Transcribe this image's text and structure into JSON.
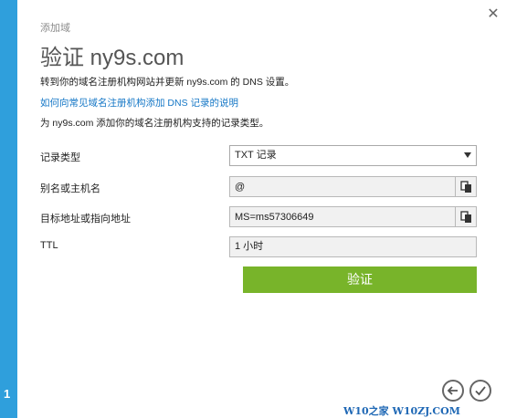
{
  "step": {
    "number": "1"
  },
  "header": {
    "eyebrow": "添加域",
    "title": "验证 ny9s.com"
  },
  "instructions": {
    "main": "转到你的域名注册机构网站并更新 ny9s.com 的 DNS 设置。",
    "help_link": "如何向常见域名注册机构添加 DNS 记录的说明",
    "support": "为 ny9s.com 添加你的域名注册机构支持的记录类型。"
  },
  "fields": {
    "record_type": {
      "label": "记录类型",
      "value": "TXT 记录"
    },
    "alias": {
      "label": "别名或主机名",
      "value": "@"
    },
    "target": {
      "label": "目标地址或指向地址",
      "value": "MS=ms57306649"
    },
    "ttl": {
      "label": "TTL",
      "value": "1 小时"
    }
  },
  "actions": {
    "verify_label": "验证"
  },
  "icons": {
    "close": "close-icon",
    "copy": "copy-icon",
    "back": "back-arrow-icon",
    "confirm": "checkmark-icon"
  },
  "colors": {
    "accent": "#2f9fdc",
    "verify": "#78b42a",
    "link": "#1577c6",
    "watermark": "#1f68b5"
  },
  "watermark": {
    "text": "W10之家 W10ZJ.COM"
  }
}
